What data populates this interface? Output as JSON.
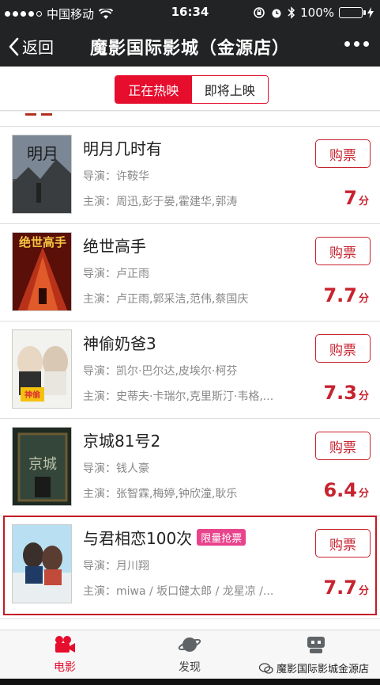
{
  "status_bar": {
    "carrier": "中国移动",
    "time": "16:34",
    "battery": "100%"
  },
  "nav": {
    "back_label": "返回",
    "title": "魔影国际影城（金源店）"
  },
  "tabs": {
    "now_playing": "正在热映",
    "coming_soon": "即将上映"
  },
  "movies": [
    {
      "title": "明月几时有",
      "badge": "",
      "director": "导演：许鞍华",
      "cast": "主演：周迅,彭于晏,霍建华,郭涛",
      "score": "7",
      "score_unit": "分",
      "buy_label": "购票"
    },
    {
      "title": "绝世高手",
      "badge": "",
      "director": "导演：卢正雨",
      "cast": "主演：卢正雨,郭采洁,范伟,蔡国庆",
      "score": "7.7",
      "score_unit": "分",
      "buy_label": "购票"
    },
    {
      "title": "神偷奶爸3",
      "badge": "",
      "director": "导演：凯尔·巴尔达,皮埃尔·柯芬",
      "cast": "主演：史蒂夫·卡瑞尔,克里斯汀·韦格,...",
      "score": "7.3",
      "score_unit": "分",
      "buy_label": "购票"
    },
    {
      "title": "京城81号2",
      "badge": "",
      "director": "导演：钱人豪",
      "cast": "主演：张智霖,梅婷,钟欣潼,耿乐",
      "score": "6.4",
      "score_unit": "分",
      "buy_label": "购票"
    },
    {
      "title": "与君相恋100次",
      "badge": "限量抢票",
      "director": "导演：月川翔",
      "cast": "主演：miwa / 坂口健太郎 / 龙星凉 /...",
      "score": "7.7",
      "score_unit": "分",
      "buy_label": "购票"
    }
  ],
  "bottom_nav": {
    "movies": "电影",
    "discover": "发现",
    "watermark": "魔影国际影城金源店"
  },
  "colors": {
    "accent": "#e60d2d",
    "score": "#c7232f",
    "badge": "#e8438c",
    "bar_bg": "#222325"
  }
}
